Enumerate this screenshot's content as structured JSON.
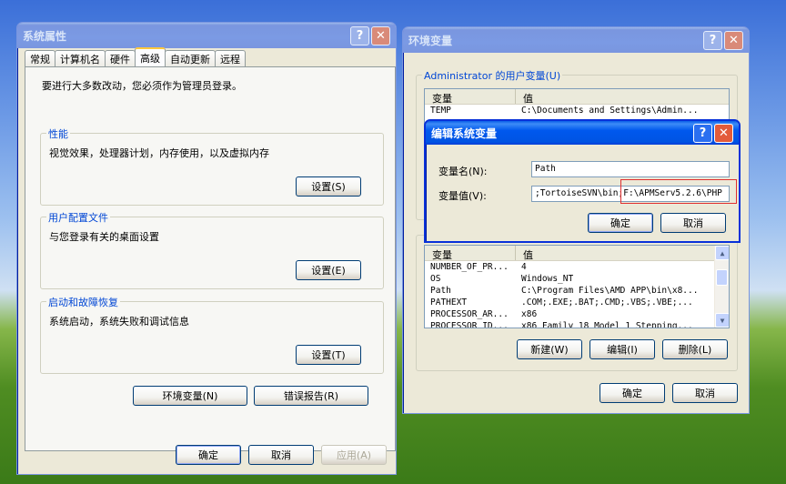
{
  "sysprops": {
    "title": "系统属性",
    "help": "?",
    "close": "✕",
    "tabs": [
      "常规",
      "计算机名",
      "硬件",
      "高级",
      "自动更新",
      "远程"
    ],
    "admin_note": "要进行大多数改动，您必须作为管理员登录。",
    "perf": {
      "label": "性能",
      "text": "视觉效果，处理器计划，内存使用，以及虚拟内存",
      "btn": "设置(S)"
    },
    "profile": {
      "label": "用户配置文件",
      "text": "与您登录有关的桌面设置",
      "btn": "设置(E)"
    },
    "startup": {
      "label": "启动和故障恢复",
      "text": "系统启动，系统失败和调试信息",
      "btn": "设置(T)"
    },
    "env_btn": "环境变量(N)",
    "err_btn": "错误报告(R)",
    "ok": "确定",
    "cancel": "取消",
    "apply": "应用(A)"
  },
  "envvars": {
    "title": "环境变量",
    "help": "?",
    "close": "✕",
    "user_label": "Administrator 的用户变量(U)",
    "col_var": "变量",
    "col_val": "值",
    "user_rows": [
      {
        "name": "TEMP",
        "value": "C:\\Documents and Settings\\Admin..."
      }
    ],
    "sys_rows": [
      {
        "name": "NUMBER_OF_PR...",
        "value": "4"
      },
      {
        "name": "OS",
        "value": "Windows_NT"
      },
      {
        "name": "Path",
        "value": "C:\\Program Files\\AMD APP\\bin\\x8..."
      },
      {
        "name": "PATHEXT",
        "value": ".COM;.EXE;.BAT;.CMD;.VBS;.VBE;..."
      },
      {
        "name": "PROCESSOR_AR...",
        "value": "x86"
      },
      {
        "name": "PROCESSOR_ID...",
        "value": "x86 Family 18 Model 1 Stepping..."
      }
    ],
    "new_btn": "新建(W)",
    "edit_btn": "编辑(I)",
    "del_btn": "删除(L)",
    "ok": "确定",
    "cancel": "取消"
  },
  "editdlg": {
    "title": "编辑系统变量",
    "help": "?",
    "close": "✕",
    "name_label": "变量名(N):",
    "name_value": "Path",
    "value_label": "变量值(V):",
    "value_value": ";TortoiseSVN\\bin;F:\\APMServ5.2.6\\PHP",
    "ok": "确定",
    "cancel": "取消",
    "highlight_color": "#e03030"
  }
}
